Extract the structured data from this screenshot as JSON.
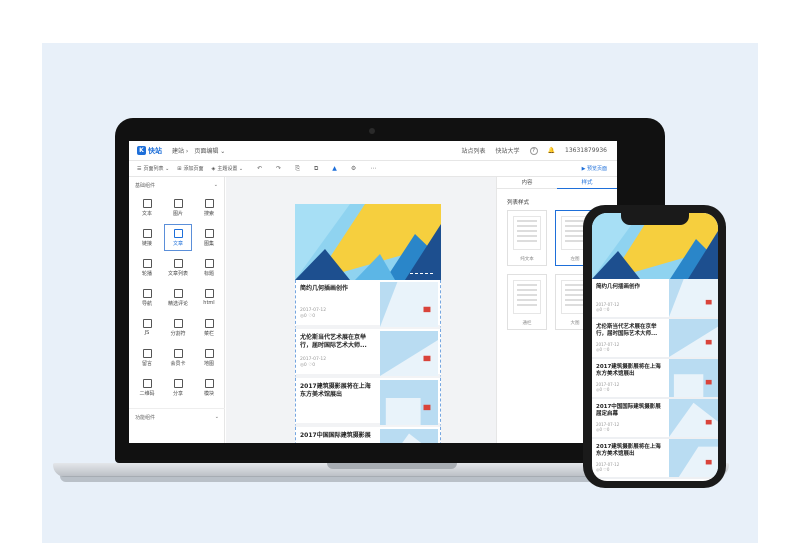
{
  "editor": {
    "logo_mark": "K",
    "logo_text": "快站",
    "breadcrumb": [
      "建站 ›",
      "页面编辑 ⌄"
    ],
    "top_links": [
      "站点列表",
      "快站大学"
    ],
    "help_symbol": "?",
    "bell_symbol": "🔔",
    "phone_number": "13631879936",
    "toolbar": {
      "page_list": "页面列表 ⌄",
      "add_page": "添加页面",
      "theme": "主题设置 ⌄",
      "icons": [
        "↶",
        "↷",
        "⎘",
        "⧉",
        "▲",
        "⚙",
        "⋯"
      ],
      "preview": "▶ 预览页面"
    }
  },
  "components": {
    "section_title": "基础组件",
    "section_toggle": "⌄",
    "items": [
      {
        "label": "文本"
      },
      {
        "label": "图片"
      },
      {
        "label": "搜索"
      },
      {
        "label": "链接"
      },
      {
        "label": "文章",
        "active": true
      },
      {
        "label": "图集"
      },
      {
        "label": "轮播"
      },
      {
        "label": "文章列表"
      },
      {
        "label": "标题"
      },
      {
        "label": "导航"
      },
      {
        "label": "精选评论"
      },
      {
        "label": "html"
      },
      {
        "label": "JS"
      },
      {
        "label": "分割符"
      },
      {
        "label": "菜栏"
      },
      {
        "label": "留言"
      },
      {
        "label": "会员卡"
      },
      {
        "label": "地图"
      },
      {
        "label": "二维码"
      },
      {
        "label": "分享"
      },
      {
        "label": "模块"
      }
    ],
    "section2_title": "功能组件",
    "section2_toggle": "⌄"
  },
  "canvas_articles": [
    {
      "title": "简约几何插画创作",
      "date": "2017-07-12",
      "meta": "◎0 ♡0"
    },
    {
      "title": "尤伦斯当代艺术展在京举行，届时国际艺术大师...",
      "date": "2017-07-12",
      "meta": "◎0 ♡0"
    },
    {
      "title": "2017建筑摄影展将在上海东方美术馆展出",
      "date": "",
      "meta": ""
    },
    {
      "title": "2017中国国际建筑摄影展",
      "date": "",
      "meta": ""
    }
  ],
  "right_panel": {
    "tabs": [
      "内容",
      "样式"
    ],
    "active_tab": 1,
    "list_style_label": "列表样式",
    "styles": [
      {
        "caption": "纯文本"
      },
      {
        "caption": "左图"
      },
      {
        "caption": "通栏"
      },
      {
        "caption": "大图"
      }
    ]
  },
  "phone_articles": [
    {
      "title": "简约几何插画创作",
      "date": "2017-07-12",
      "meta": "◎0 ♡0"
    },
    {
      "title": "尤伦斯当代艺术展在京举行，届时国际艺术大师...",
      "date": "2017-07-12",
      "meta": "◎0 ♡0"
    },
    {
      "title": "2017建筑摄影展将在上海东方美术馆展出",
      "date": "2017-07-12",
      "meta": "◎0 ♡0"
    },
    {
      "title": "2017中国国际建筑摄影展届定启幕",
      "date": "2017-07-12",
      "meta": "◎0 ♡0"
    },
    {
      "title": "2017建筑摄影展将在上海东方美术馆展出",
      "date": "2017-07-12",
      "meta": "◎0 ♡0"
    }
  ],
  "colors": {
    "accent": "#1e6fd9",
    "yellow": "#f6cf3e",
    "blue_dark": "#1d4f8f",
    "sky": "#8fd3f0"
  }
}
